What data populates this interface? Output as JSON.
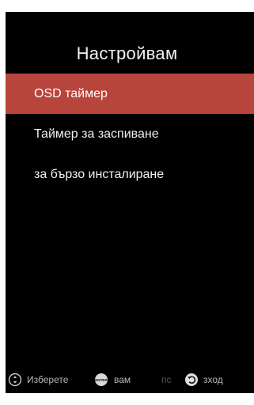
{
  "menu": {
    "title": "Настройвам",
    "items": [
      {
        "label": "OSD таймер",
        "selected": true
      },
      {
        "label": "Таймер за заспиване",
        "selected": false
      },
      {
        "label": "за бързо инсталиране",
        "selected": false
      }
    ]
  },
  "footer": {
    "select_icon": "up-down-icon",
    "select_label": "Изберете",
    "enter_icon": "enter-icon",
    "enter_icon_text": "ENTER",
    "enter_label": "вам",
    "back_fragment": "пс",
    "back_icon": "return-icon",
    "back_label": "зход"
  },
  "colors": {
    "background": "#000000",
    "selected_row": "#b8453b",
    "text": "#ffffff",
    "footer_text": "#b5b5b5"
  }
}
